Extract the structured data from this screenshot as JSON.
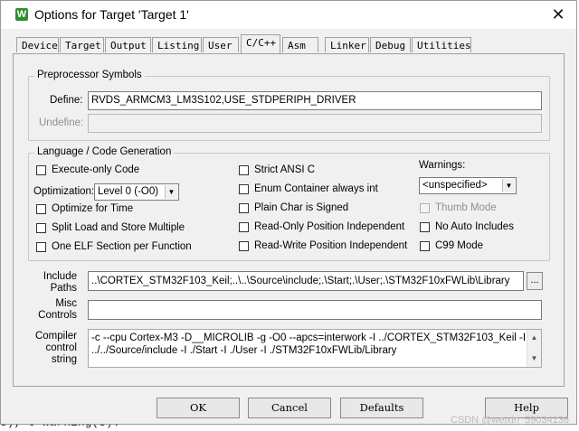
{
  "window": {
    "title": "Options for Target 'Target 1'",
    "app_icon_letter": "W",
    "close_glyph": "✕"
  },
  "tabs": [
    {
      "label": "Device"
    },
    {
      "label": "Target"
    },
    {
      "label": "Output"
    },
    {
      "label": "Listing"
    },
    {
      "label": "User"
    },
    {
      "label": "C/C++"
    },
    {
      "label": "Asm"
    },
    {
      "label": "Linker"
    },
    {
      "label": "Debug"
    },
    {
      "label": "Utilities"
    }
  ],
  "active_tab": "C/C++",
  "preprocessor": {
    "group_title": "Preprocessor Symbols",
    "define_label": "Define:",
    "define_value": "RVDS_ARMCM3_LM3S102,USE_STDPERIPH_DRIVER",
    "undefine_label": "Undefine:",
    "undefine_value": ""
  },
  "language": {
    "group_title": "Language / Code Generation",
    "execute_only": "Execute-only Code",
    "optimization_label": "Optimization:",
    "optimization_value": "Level 0 (-O0)",
    "optimize_time": "Optimize for Time",
    "split_load": "Split Load and Store Multiple",
    "one_elf": "One ELF Section per Function",
    "strict_ansi": "Strict ANSI C",
    "enum_container": "Enum Container always int",
    "plain_char": "Plain Char is Signed",
    "ro_pos": "Read-Only Position Independent",
    "rw_pos": "Read-Write Position Independent",
    "warnings_label": "Warnings:",
    "warnings_value": "<unspecified>",
    "thumb_mode": "Thumb Mode",
    "no_auto_includes": "No Auto Includes",
    "c99_mode": "C99 Mode"
  },
  "include": {
    "label_line1": "Include",
    "label_line2": "Paths",
    "value": "..\\CORTEX_STM32F103_Keil;..\\..\\Source\\include;.\\Start;.\\User;.\\STM32F10xFWLib\\Library",
    "browse_label": "..."
  },
  "misc": {
    "label_line1": "Misc",
    "label_line2": "Controls",
    "value": ""
  },
  "compiler": {
    "label_line1": "Compiler",
    "label_line2": "control",
    "label_line3": "string",
    "line1": "-c --cpu Cortex-M3 -D__MICROLIB -g -O0 --apcs=interwork -I ../CORTEX_STM32F103_Keil -I",
    "line2": "../../Source/include -I ./Start -I ./User -I ./STM32F10xFWLib/Library"
  },
  "buttons": {
    "ok": "OK",
    "cancel": "Cancel",
    "defaults": "Defaults",
    "help": "Help"
  },
  "background": {
    "partial_line": "s), 0 Warning(s).",
    "side_p": "p",
    "side_b": "b"
  },
  "watermark": "CSDN @weixin_59034136"
}
